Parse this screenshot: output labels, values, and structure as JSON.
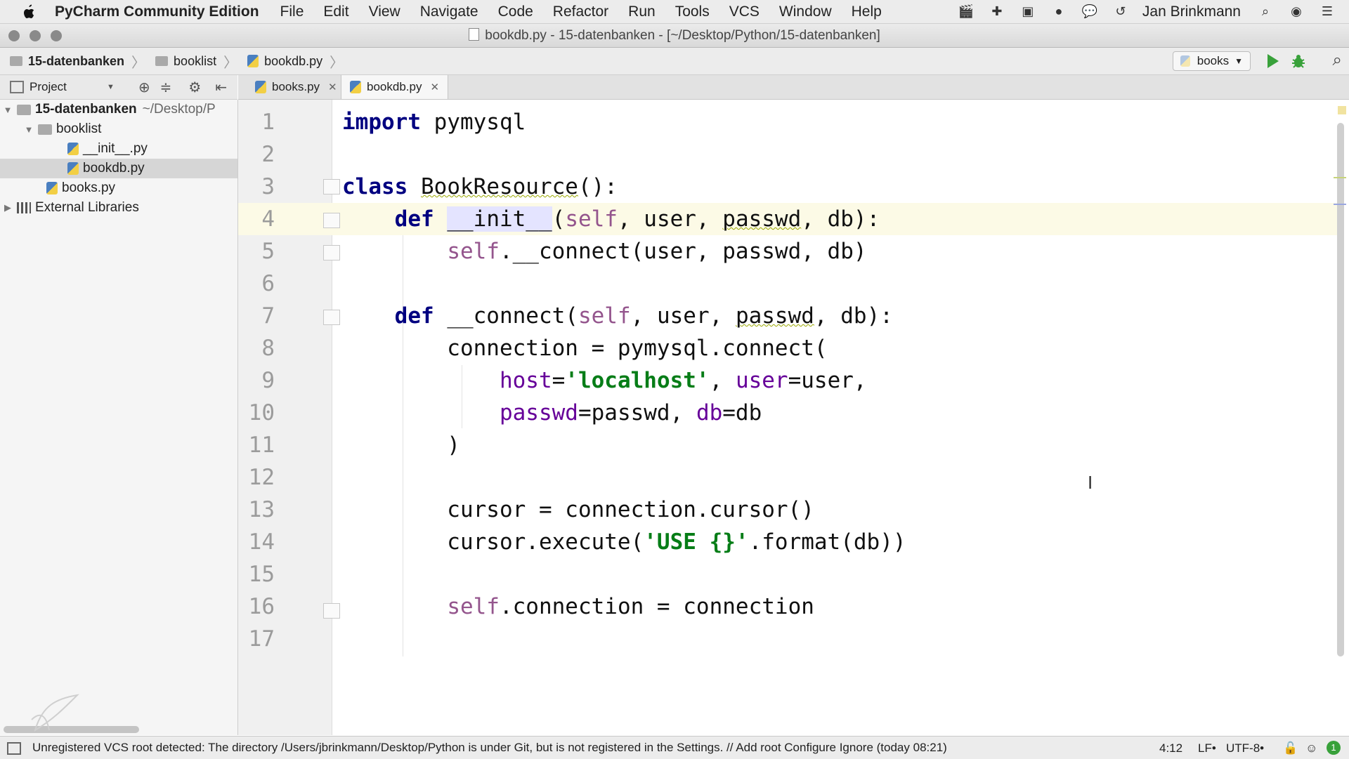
{
  "menubar": {
    "app_name": "PyCharm Community Edition",
    "items": [
      "File",
      "Edit",
      "View",
      "Navigate",
      "Code",
      "Refactor",
      "Run",
      "Tools",
      "VCS",
      "Window",
      "Help"
    ],
    "user": "Jan Brinkmann"
  },
  "window": {
    "title": "bookdb.py - 15-datenbanken - [~/Desktop/Python/15-datenbanken]"
  },
  "breadcrumbs": [
    "15-datenbanken",
    "booklist",
    "bookdb.py"
  ],
  "run_config": "books",
  "project_panel": {
    "header": "Project",
    "tree": [
      {
        "label": "15-datenbanken",
        "suffix": "~/Desktop/P",
        "type": "folder",
        "depth": 0,
        "expanded": true
      },
      {
        "label": "booklist",
        "type": "folder",
        "depth": 1,
        "expanded": true
      },
      {
        "label": "__init__.py",
        "type": "py",
        "depth": 2
      },
      {
        "label": "bookdb.py",
        "type": "py",
        "depth": 2,
        "selected": true
      },
      {
        "label": "books.py",
        "type": "py",
        "depth": 1
      },
      {
        "label": "External Libraries",
        "type": "lib",
        "depth": 0,
        "expanded": false
      }
    ]
  },
  "tabs": [
    {
      "label": "books.py",
      "active": false
    },
    {
      "label": "bookdb.py",
      "active": true
    }
  ],
  "editor": {
    "current_line": 4,
    "line_numbers": [
      "1",
      "2",
      "3",
      "4",
      "5",
      "6",
      "7",
      "8",
      "9",
      "10",
      "11",
      "12",
      "13",
      "14",
      "15",
      "16",
      "17"
    ]
  },
  "status": {
    "message": "Unregistered VCS root detected: The directory /Users/jbrinkmann/Desktop/Python is under Git, but is not registered in the Settings. // Add root  Configure  Ignore (today 08:21)",
    "position": "4:12",
    "line_sep": "LF•",
    "encoding": "UTF-8•",
    "badge": "1"
  },
  "colors": {
    "keyword": "#000080",
    "self": "#94558d",
    "string": "#067d17",
    "param": "#660099",
    "run": "#38a13a"
  }
}
